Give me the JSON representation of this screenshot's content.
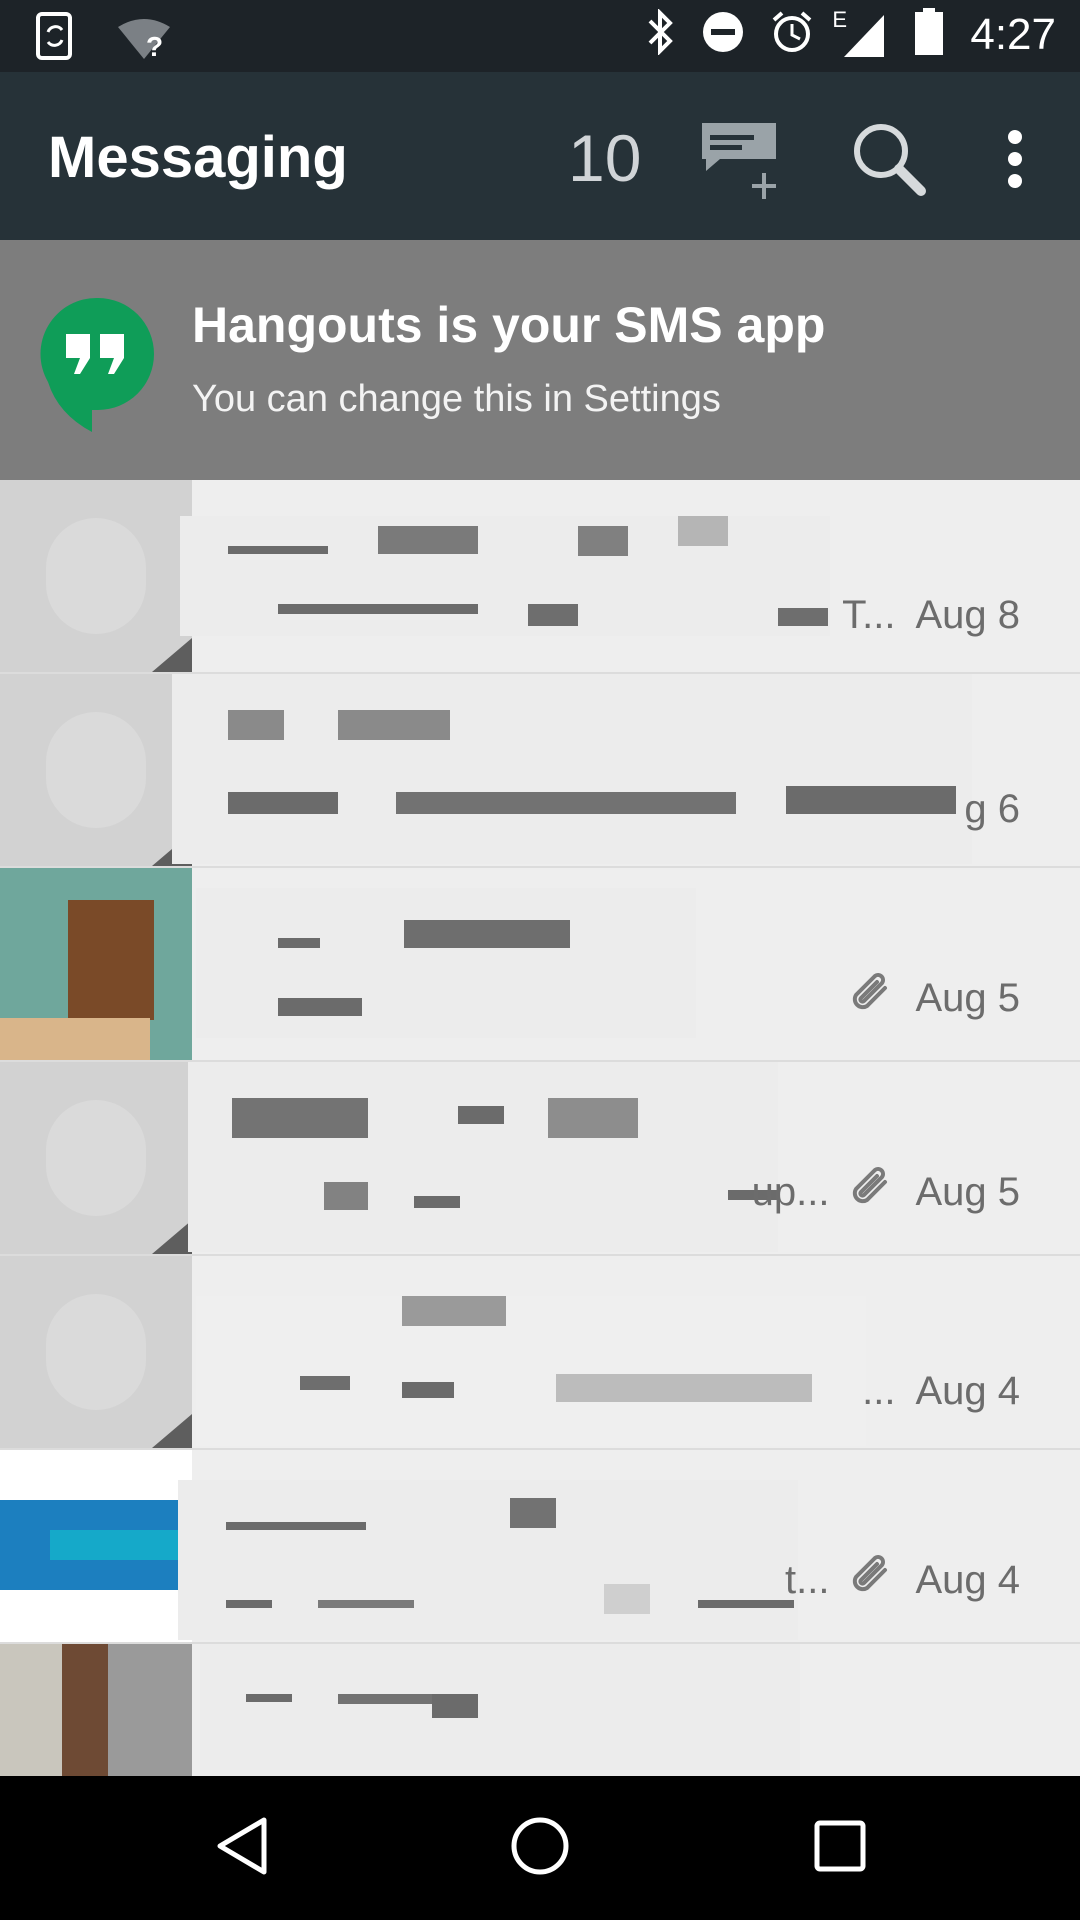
{
  "status_bar": {
    "time": "4:27",
    "icons": [
      "phone-sync-icon",
      "wifi-unknown-icon",
      "bluetooth-icon",
      "do-not-disturb-icon",
      "alarm-icon",
      "signal-edge-icon",
      "battery-icon"
    ],
    "network_label": "E",
    "wifi_label": "?"
  },
  "app_bar": {
    "title": "Messaging",
    "unread_count": "10",
    "actions": [
      "new-conversation-icon",
      "search-icon",
      "more-options-icon"
    ]
  },
  "banner": {
    "title": "Hangouts is your SMS app",
    "subtitle": "You can change this in Settings"
  },
  "conversations": [
    {
      "snippet_tail": "T...",
      "date": "Aug 8",
      "attachment": false
    },
    {
      "snippet_tail": "g 6",
      "date": "",
      "attachment": false
    },
    {
      "snippet_tail": "",
      "date": "Aug 5",
      "attachment": true
    },
    {
      "snippet_tail": "up...",
      "date": "Aug 5",
      "attachment": true
    },
    {
      "snippet_tail": "...",
      "date": "Aug 4",
      "attachment": false
    },
    {
      "snippet_tail": "t...",
      "date": "Aug 4",
      "attachment": true
    },
    {
      "snippet_tail": "",
      "date": "",
      "attachment": false
    }
  ],
  "nav_bar": [
    "back-icon",
    "home-icon",
    "recents-icon"
  ]
}
